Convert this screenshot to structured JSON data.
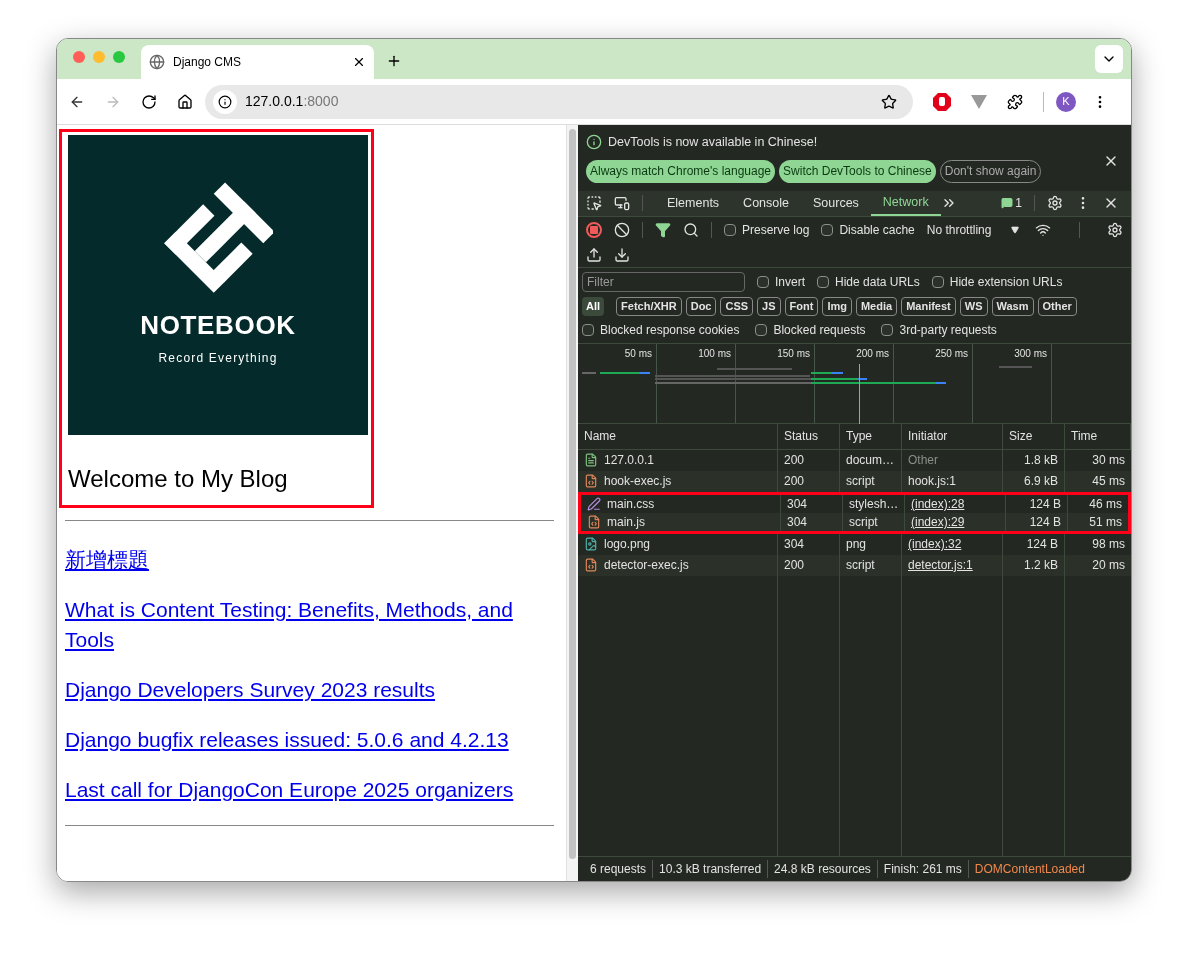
{
  "browser": {
    "tab": {
      "title": "Django CMS"
    },
    "address": {
      "host": "127.0.0.1",
      "port": ":8000"
    },
    "back_disabled": false,
    "forward_disabled": true,
    "profile": {
      "initial": "K"
    }
  },
  "page": {
    "header": {
      "highlighted": true,
      "logo": {
        "title": "NOTEBOOK",
        "tagline": "Record Everything"
      },
      "heading": "Welcome to My Blog"
    },
    "links": [
      {
        "text": "新增標題"
      },
      {
        "text": "What is Content Testing: Benefits, Methods, and Tools"
      },
      {
        "text": "Django Developers Survey 2023 results"
      },
      {
        "text": "Django bugfix releases issued: 5.0.6 and 4.2.13"
      },
      {
        "text": "Last call for DjangoCon Europe 2025 organizers"
      }
    ]
  },
  "devtools": {
    "infobar": {
      "message": "DevTools is now available in Chinese!",
      "buttons": [
        {
          "label": "Always match Chrome's language",
          "kind": "primary"
        },
        {
          "label": "Switch DevTools to Chinese",
          "kind": "primary"
        },
        {
          "label": "Don't show again",
          "kind": "outline"
        }
      ]
    },
    "tabs": [
      {
        "label": "Elements",
        "selected": false
      },
      {
        "label": "Console",
        "selected": false
      },
      {
        "label": "Sources",
        "selected": false
      },
      {
        "label": "Network",
        "selected": true
      }
    ],
    "issues_count": "1",
    "toolbar": {
      "recording": true,
      "filter_active": true,
      "checkboxes": [
        {
          "label": "Preserve log",
          "checked": false
        },
        {
          "label": "Disable cache",
          "checked": false
        }
      ],
      "throttling": "No throttling"
    },
    "filter": {
      "placeholder": "Filter",
      "checkboxes": [
        {
          "label": "Invert",
          "checked": false
        },
        {
          "label": "Hide data URLs",
          "checked": false
        },
        {
          "label": "Hide extension URLs",
          "checked": false
        }
      ]
    },
    "type_filters": [
      {
        "label": "All",
        "selected": true
      },
      {
        "label": "Fetch/XHR",
        "selected": false
      },
      {
        "label": "Doc",
        "selected": false
      },
      {
        "label": "CSS",
        "selected": false
      },
      {
        "label": "JS",
        "selected": false
      },
      {
        "label": "Font",
        "selected": false
      },
      {
        "label": "Img",
        "selected": false
      },
      {
        "label": "Media",
        "selected": false
      },
      {
        "label": "Manifest",
        "selected": false
      },
      {
        "label": "WS",
        "selected": false
      },
      {
        "label": "Wasm",
        "selected": false
      },
      {
        "label": "Other",
        "selected": false
      }
    ],
    "blocked_filters": [
      {
        "label": "Blocked response cookies",
        "checked": false
      },
      {
        "label": "Blocked requests",
        "checked": false
      },
      {
        "label": "3rd-party requests",
        "checked": false
      }
    ],
    "timeline": {
      "ticks": [
        "50 ms",
        "100 ms",
        "150 ms",
        "200 ms",
        "250 ms",
        "300 ms"
      ]
    },
    "table": {
      "columns": [
        "Name",
        "Status",
        "Type",
        "Initiator",
        "Size",
        "Time"
      ],
      "rows": [
        {
          "kind": "document",
          "name": "127.0.0.1",
          "status": "200",
          "type": "docum…",
          "initiator": "Other",
          "initiator_link": false,
          "size": "1.8 kB",
          "time": "30 ms",
          "highlighted": false
        },
        {
          "kind": "script",
          "name": "hook-exec.js",
          "status": "200",
          "type": "script",
          "initiator": "hook.js:1",
          "initiator_link": false,
          "size": "6.9 kB",
          "time": "45 ms",
          "highlighted": false
        },
        {
          "kind": "stylesheet",
          "name": "main.css",
          "status": "304",
          "type": "stylesh…",
          "initiator": "(index):28",
          "initiator_link": true,
          "size": "124 B",
          "time": "46 ms",
          "highlighted": true
        },
        {
          "kind": "script",
          "name": "main.js",
          "status": "304",
          "type": "script",
          "initiator": "(index):29",
          "initiator_link": true,
          "size": "124 B",
          "time": "51 ms",
          "highlighted": true
        },
        {
          "kind": "image",
          "name": "logo.png",
          "status": "304",
          "type": "png",
          "initiator": "(index):32",
          "initiator_link": true,
          "size": "124 B",
          "time": "98 ms",
          "highlighted": false
        },
        {
          "kind": "script",
          "name": "detector-exec.js",
          "status": "200",
          "type": "script",
          "initiator": "detector.js:1",
          "initiator_link": true,
          "size": "1.2 kB",
          "time": "20 ms",
          "highlighted": false
        }
      ]
    },
    "status_bar": [
      {
        "text": "6 requests",
        "kind": "stat"
      },
      {
        "text": "10.3 kB transferred",
        "kind": "stat"
      },
      {
        "text": "24.8 kB resources",
        "kind": "stat"
      },
      {
        "text": "Finish: 261 ms",
        "kind": "stat"
      },
      {
        "text": "DOMContentLoaded",
        "kind": "event"
      }
    ]
  }
}
